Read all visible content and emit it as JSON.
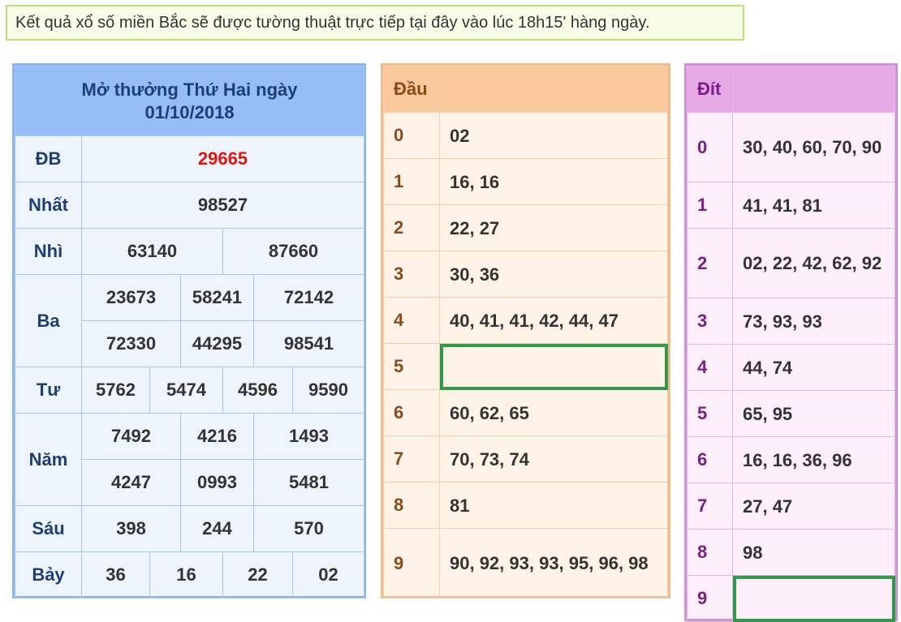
{
  "notice": "Kết quả xổ số miền Bắc sẽ được tường thuật trực tiếp tại đây vào lúc 18h15' hàng ngày.",
  "results": {
    "title_line1": "Mở thưởng Thứ Hai ngày",
    "title_line2": "01/10/2018",
    "prizes": {
      "db": {
        "label": "ĐB",
        "values": [
          "29665"
        ]
      },
      "nhat": {
        "label": "Nhất",
        "values": [
          "98527"
        ]
      },
      "nhi": {
        "label": "Nhì",
        "values": [
          "63140",
          "87660"
        ]
      },
      "ba": {
        "label": "Ba",
        "values": [
          "23673",
          "58241",
          "72142",
          "72330",
          "44295",
          "98541"
        ]
      },
      "tu": {
        "label": "Tư",
        "values": [
          "5762",
          "5474",
          "4596",
          "9590"
        ]
      },
      "nam": {
        "label": "Năm",
        "values": [
          "7492",
          "4216",
          "1493",
          "4247",
          "0993",
          "5481"
        ]
      },
      "sau": {
        "label": "Sáu",
        "values": [
          "398",
          "244",
          "570"
        ]
      },
      "bay": {
        "label": "Bảy",
        "values": [
          "36",
          "16",
          "22",
          "02"
        ]
      }
    },
    "special_color": "#e3120b"
  },
  "dau": {
    "header": "Đầu",
    "rows": [
      {
        "key": "0",
        "value": "02"
      },
      {
        "key": "1",
        "value": "16, 16"
      },
      {
        "key": "2",
        "value": "22, 27"
      },
      {
        "key": "3",
        "value": "30, 36"
      },
      {
        "key": "4",
        "value": "40, 41, 41, 42, 44, 47"
      },
      {
        "key": "5",
        "value": ""
      },
      {
        "key": "6",
        "value": "60, 62, 65"
      },
      {
        "key": "7",
        "value": "70, 73, 74"
      },
      {
        "key": "8",
        "value": "81"
      },
      {
        "key": "9",
        "value": "90, 92, 93, 93, 95, 96, 98"
      }
    ]
  },
  "dit": {
    "header": "Đít",
    "rows": [
      {
        "key": "0",
        "value": "30, 40, 60, 70, 90"
      },
      {
        "key": "1",
        "value": "41, 41, 81"
      },
      {
        "key": "2",
        "value": "02, 22, 42, 62, 92"
      },
      {
        "key": "3",
        "value": "73, 93, 93"
      },
      {
        "key": "4",
        "value": "44, 74"
      },
      {
        "key": "5",
        "value": "65, 95"
      },
      {
        "key": "6",
        "value": "16, 16, 36, 96"
      },
      {
        "key": "7",
        "value": "27, 47"
      },
      {
        "key": "8",
        "value": "98"
      },
      {
        "key": "9",
        "value": ""
      }
    ]
  }
}
